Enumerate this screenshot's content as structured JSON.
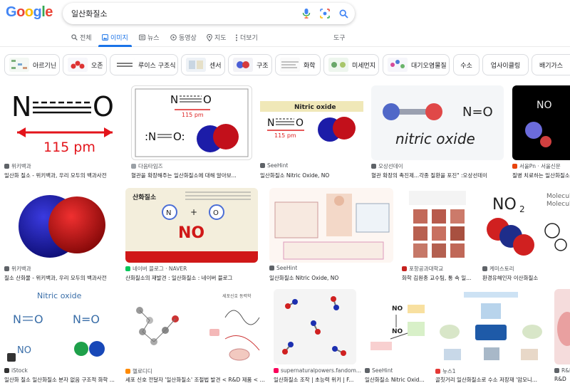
{
  "logo": {
    "letters": [
      "G",
      "o",
      "o",
      "g",
      "l",
      "e"
    ],
    "colors": [
      "#4285f4",
      "#ea4335",
      "#fbbc05",
      "#4285f4",
      "#34a853",
      "#ea4335"
    ]
  },
  "search": {
    "query": "일산화질소"
  },
  "tabs": [
    {
      "label": "전체",
      "icon": "search-icon"
    },
    {
      "label": "이미지",
      "icon": "image-icon",
      "active": true
    },
    {
      "label": "뉴스",
      "icon": "news-icon"
    },
    {
      "label": "동영상",
      "icon": "video-icon"
    },
    {
      "label": "지도",
      "icon": "map-pin-icon"
    },
    {
      "label": "더보기",
      "icon": "more-vert-icon"
    },
    {
      "label": "도구",
      "icon": ""
    }
  ],
  "chips": [
    "아르기닌",
    "오존",
    "루이스 구조식",
    "센서",
    "구조",
    "화학",
    "미세먼지",
    "대기오염물질",
    "수소",
    "업사이클링",
    "배기가스"
  ],
  "results": [
    {
      "source": "위키백과",
      "title": "일산화 질소 - 위키백과, 우리 모두의 백과사전",
      "fav_color": "#5f6368",
      "img_text": {
        "n": "N",
        "o": "O",
        "length": "115 pm"
      }
    },
    {
      "source": "다음타임즈",
      "title": "혈관을 확장해주는 일산화질소에 대해 알아보...",
      "fav_color": "#9aa0a6",
      "img_text": {
        "n": "N",
        "o": "O",
        "length": "115 pm",
        "n2": ":N",
        "o2": "O:"
      }
    },
    {
      "source": "SeeHint",
      "title": "일산화질소 Nitric Oxide, NO",
      "fav_color": "#5f6368",
      "img_text": {
        "header": "Nitric oxide",
        "n": "N",
        "o": "O",
        "length": "115 pm"
      }
    },
    {
      "source": "오상선데이",
      "title": "혈관 확장의 촉진제...각종 질환을 포진\" :오상선데이",
      "fav_color": "#5f6368",
      "img_text": {
        "formula": "N=O",
        "name": "nitric oxide"
      }
    },
    {
      "source": "서울Pn · 서울신문",
      "title": "질병 치료하는 일산화질소",
      "fav_color": "#e8430c",
      "img_text": {
        "label": "NO"
      }
    },
    {
      "source": "위키백과",
      "title": "질소 산화물 - 위키백과, 우리 모두의 백과사전",
      "fav_color": "#5f6368"
    },
    {
      "source": "네이버 블로그 · NAVER",
      "title": "산화질소의 재발견 : 일산화질소 : 네이버 블로그",
      "fav_color": "#03c75a",
      "img_text": {
        "heading": "산화질소",
        "n": "N",
        "o": "O",
        "big": "NO"
      }
    },
    {
      "source": "SeeHint",
      "title": "일산화질소 Nitric Oxide, NO",
      "fav_color": "#5f6368"
    },
    {
      "source": "포항공과대학교",
      "title": "화학 김원종 교수팀, 통 속 일...",
      "fav_color": "#c5221f"
    },
    {
      "source": "케미스토리",
      "title": "환경유해인자 이산화질소",
      "fav_color": "#5f6368",
      "img_text": {
        "formula": "NO",
        "sub": "2",
        "label": "Molecul",
        "label2": "Molecula"
      }
    },
    {
      "source": "iStock",
      "title": "일산화 질소 일산화질소 분자 없음 구조적 화학 ...",
      "fav_color": "#333333",
      "img_text": {
        "header": "Nitric oxide",
        "n": "N",
        "o": "O",
        "label": "NO"
      }
    },
    {
      "source": "헬로디디",
      "title": "세포 신호 전달자 '일산화질소' 조절법 발견 < R&D 제품 < 뉴...",
      "fav_color": "#ff8a00",
      "img_text": {
        "right_title": "세포신호 동력학"
      }
    },
    {
      "source": "supernaturalpowers.fandom...",
      "title": "일산화질소 조작 | 초능력 위키 | F...",
      "fav_color": "#fa005a"
    },
    {
      "source": "SeeHint",
      "title": "일산화질소 Nitric Oxide, NO",
      "fav_color": "#5f6368",
      "img_text": {
        "no": "NO"
      }
    },
    {
      "source": "뉴스1",
      "title": "골칫거리 일산화질소로 수소 저장재 '암모니...",
      "fav_color": "#e53935"
    },
    {
      "source": "R&D",
      "title": "R&D",
      "fav_color": "#5f6368"
    }
  ]
}
